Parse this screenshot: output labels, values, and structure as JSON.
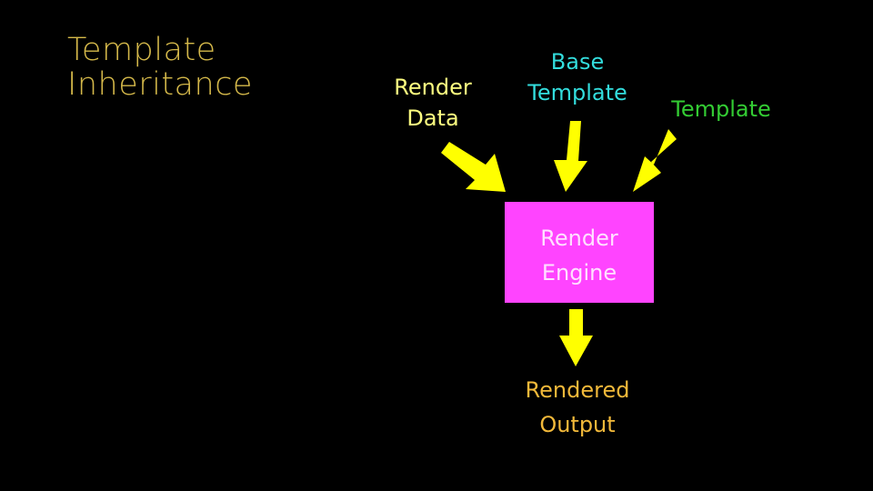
{
  "slide": {
    "title_lines": [
      "Template",
      "Inheritance"
    ]
  },
  "diagram": {
    "inputs": [
      {
        "lines": [
          "Render",
          "Data"
        ],
        "color": "#ffff80"
      },
      {
        "lines": [
          "Base",
          "Template"
        ],
        "color": "#33dddd"
      },
      {
        "lines": [
          "Template"
        ],
        "color": "#33cc33"
      }
    ],
    "engine": {
      "lines": [
        "Render",
        "Engine"
      ],
      "color": "#ff44ff"
    },
    "output": {
      "lines": [
        "Rendered",
        "Output"
      ],
      "color": "#f2b93a"
    },
    "arrow_color": "#ffff00"
  }
}
